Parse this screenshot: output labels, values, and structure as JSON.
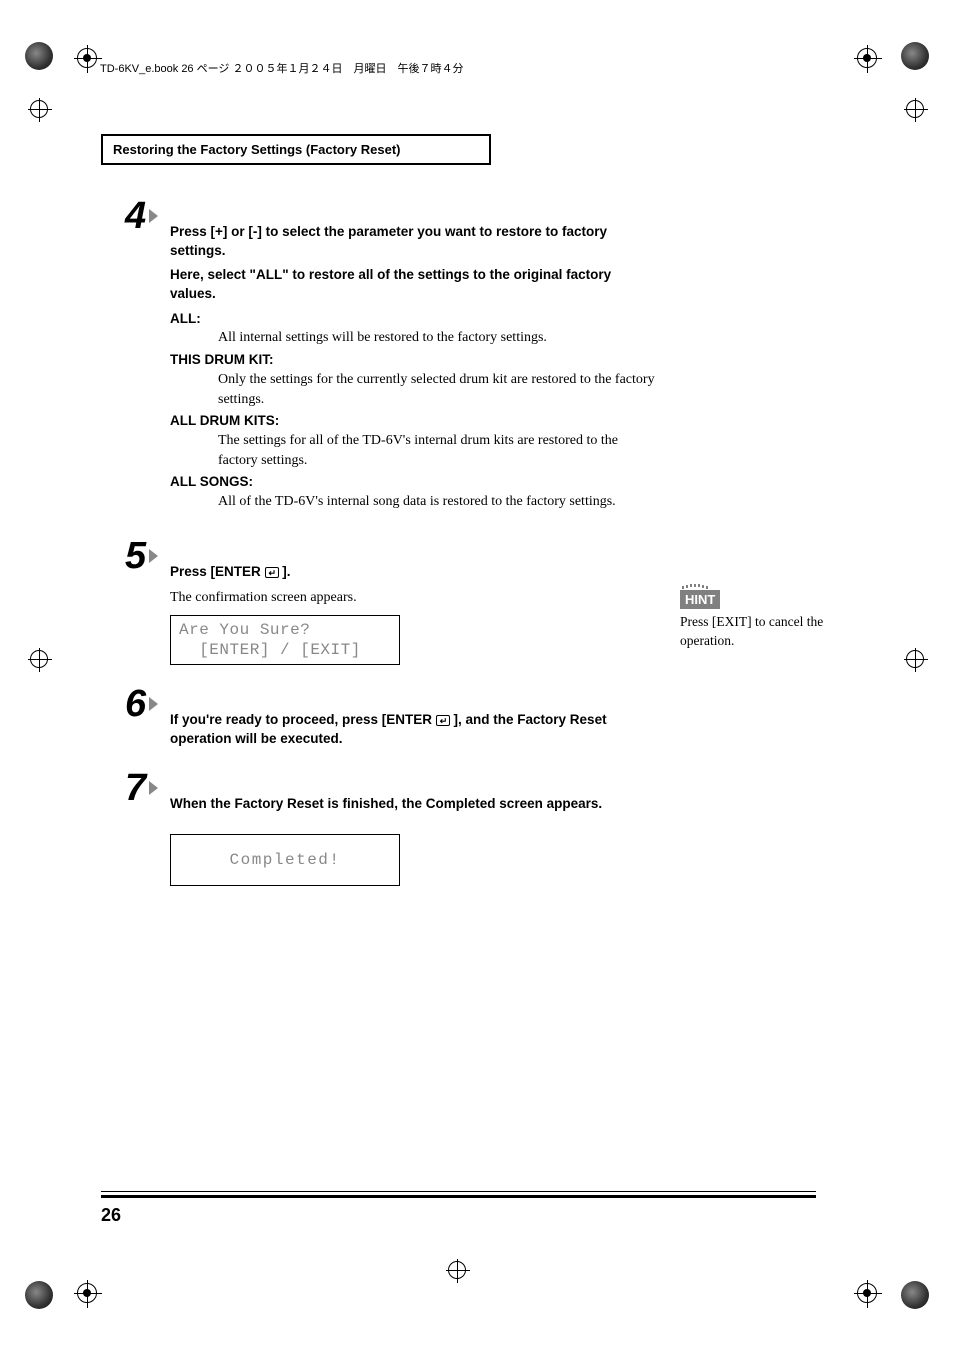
{
  "header_line": "TD-6KV_e.book  26 ページ  ２００５年１月２４日　月曜日　午後７時４分",
  "section_title": "Restoring the Factory Settings (Factory Reset)",
  "step4": {
    "num": "4",
    "instr1": "Press [+] or [-] to select the parameter you want to restore to factory settings.",
    "instr2": "Here, select \"ALL\" to restore all of the settings to the original factory values.",
    "options": {
      "all_label": "ALL:",
      "all_desc": "All internal settings will be restored to the factory settings.",
      "this_label": "THIS DRUM KIT:",
      "this_desc": "Only the settings for the currently selected drum kit are restored to the factory settings.",
      "allkits_label": "ALL DRUM KITS:",
      "allkits_desc1": "The settings for all of the TD-6V's internal drum kits are restored to the",
      "allkits_desc2": "factory settings.",
      "songs_label": "ALL SONGS:",
      "songs_desc": "All of the TD-6V's internal song data is restored to the factory settings."
    }
  },
  "step5": {
    "num": "5",
    "instr_pre": "Press [ENTER ",
    "instr_post": " ].",
    "followup": "The confirmation screen appears.",
    "lcd_line1": "Are You Sure?",
    "lcd_line2": "  [ENTER] / [EXIT]"
  },
  "step6": {
    "num": "6",
    "instr_pre": "If you're ready to proceed, press [ENTER ",
    "instr_post": " ], and the Factory Reset operation will be executed."
  },
  "step7": {
    "num": "7",
    "instr": "When the Factory Reset is finished, the Completed screen appears.",
    "lcd": "Completed!"
  },
  "hint": {
    "label": "HINT",
    "text": "Press [EXIT] to cancel the operation."
  },
  "page_number": "26"
}
